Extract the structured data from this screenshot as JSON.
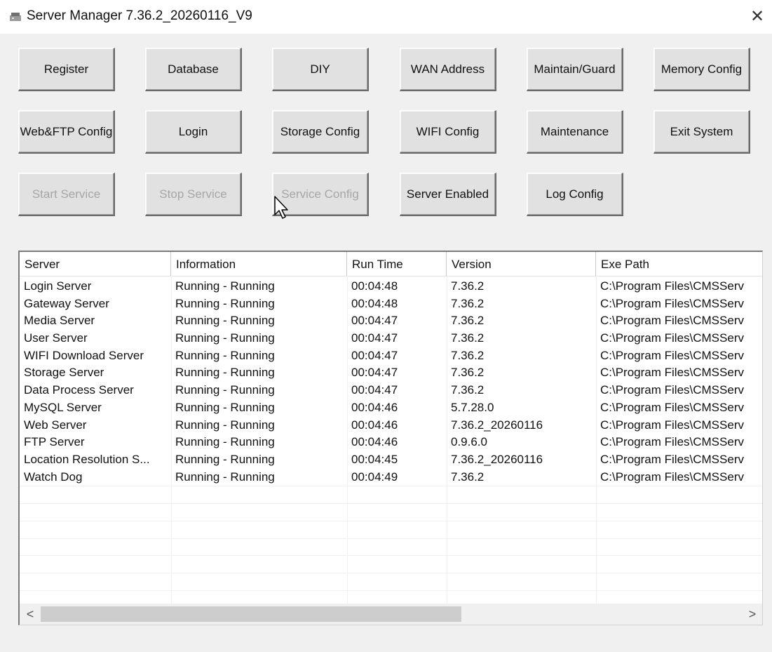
{
  "window": {
    "title": "Server Manager 7.36.2_20260116_V9",
    "close_glyph": "✕"
  },
  "buttons": {
    "row1": [
      "Register",
      "Database",
      "DIY",
      "WAN Address",
      "Maintain/Guard",
      "Memory Config"
    ],
    "row2": [
      "Web&FTP Config",
      "Login",
      "Storage Config",
      "WIFI Config",
      "Maintenance",
      "Exit System"
    ],
    "row3": [
      "Start Service",
      "Stop Service",
      "Service Config",
      "Server Enabled",
      "Log Config"
    ]
  },
  "table": {
    "columns": [
      "Server",
      "Information",
      "Run Time",
      "Version",
      "Exe Path"
    ],
    "rows": [
      [
        "Login Server",
        "Running - Running",
        "00:04:48",
        "7.36.2",
        "C:\\Program Files\\CMSServ"
      ],
      [
        "Gateway Server",
        "Running - Running",
        "00:04:48",
        "7.36.2",
        "C:\\Program Files\\CMSServ"
      ],
      [
        "Media Server",
        "Running - Running",
        "00:04:47",
        "7.36.2",
        "C:\\Program Files\\CMSServ"
      ],
      [
        "User Server",
        "Running - Running",
        "00:04:47",
        "7.36.2",
        "C:\\Program Files\\CMSServ"
      ],
      [
        "WIFI Download Server",
        "Running - Running",
        "00:04:47",
        "7.36.2",
        "C:\\Program Files\\CMSServ"
      ],
      [
        "Storage Server",
        "Running - Running",
        "00:04:47",
        "7.36.2",
        "C:\\Program Files\\CMSServ"
      ],
      [
        "Data Process Server",
        "Running - Running",
        "00:04:47",
        "7.36.2",
        "C:\\Program Files\\CMSServ"
      ],
      [
        "MySQL Server",
        "Running - Running",
        "00:04:46",
        "5.7.28.0",
        "C:\\Program Files\\CMSServ"
      ],
      [
        "Web Server",
        "Running - Running",
        "00:04:46",
        "7.36.2_20260116",
        "C:\\Program Files\\CMSServ"
      ],
      [
        "FTP Server",
        "Running - Running",
        "00:04:46",
        "0.9.6.0",
        "C:\\Program Files\\CMSServ"
      ],
      [
        "Location Resolution S...",
        "Running - Running",
        "00:04:45",
        "7.36.2_20260116",
        "C:\\Program Files\\CMSServ"
      ],
      [
        "Watch Dog",
        "Running - Running",
        "00:04:49",
        "7.36.2",
        "C:\\Program Files\\CMSServ"
      ]
    ]
  },
  "scrollbar": {
    "left_arrow": "<",
    "right_arrow": ">",
    "thumb_fraction": 0.6
  },
  "icons": {
    "app": "server-manager-app-icon",
    "cursor": "mouse-pointer-icon"
  }
}
